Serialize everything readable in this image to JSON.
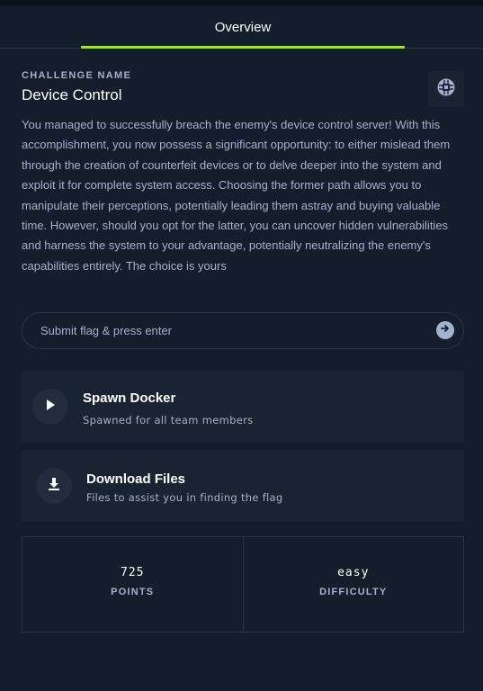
{
  "tabs": [
    {
      "label": "Overview"
    }
  ],
  "challenge": {
    "label": "CHALLENGE NAME",
    "name": "Device Control",
    "category_icon": "hardware-chip-icon",
    "description": "You managed to successfully breach the enemy's device control server! With this accomplishment, you now possess a significant opportunity: to either mislead them through the creation of counterfeit devices or to delve deeper into the system and exploit it for complete system access. Choosing the former path allows you to manipulate their perceptions, potentially leading them astray and buying valuable time. However, should you opt for the latter, you can uncover hidden vulnerabilities and harness the system to your advantage, potentially neutralizing the enemy's capabilities entirely. The choice is yours"
  },
  "flag": {
    "placeholder": "Submit flag & press enter",
    "value": "",
    "submit_icon": "arrow-right-circle-icon"
  },
  "spawn": {
    "title": "Spawn Docker",
    "subtitle": "Spawned for all team members",
    "icon": "play-icon"
  },
  "download": {
    "title": "Download Files",
    "subtitle": "Files to assist you in finding the flag",
    "icon": "download-icon"
  },
  "stats": {
    "points_value": "725",
    "points_label": "POINTS",
    "difficulty_value": "easy",
    "difficulty_label": "DIFFICULTY"
  },
  "colors": {
    "background": "#141d2b",
    "card": "#1a2332",
    "accent": "#9fef00",
    "muted_text": "#a4b1cd",
    "border": "#2a3445"
  }
}
